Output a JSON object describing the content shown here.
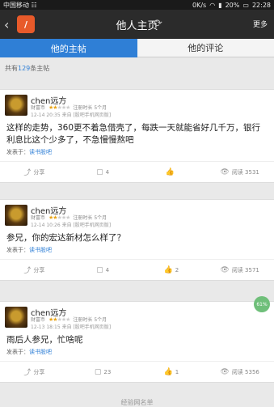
{
  "status": {
    "carrier": "中国移动 ☷",
    "speed": "0K/s",
    "battery": "20%",
    "time": "22:28"
  },
  "header": {
    "back": "‹",
    "title": "他人主页",
    "more": "更多"
  },
  "tabs": [
    "他的主帖",
    "他的评论"
  ],
  "count": {
    "prefix": "共有",
    "num": "129",
    "suffix": "条主帖"
  },
  "posts": [
    {
      "user": "chen远方",
      "level": "财富币",
      "joined": "注册时长 5个月",
      "time": "12-14 20:35",
      "device": "来自 [股吧手机网页版]",
      "content": "这样的走势，360更不着急借壳了，每跌一天就能省好几千万，银行利息比这个少多了，不急慢慢熬吧",
      "source_prefix": "发表于：",
      "source_link": "读书股吧",
      "shares": "分享",
      "comments": "4",
      "likes": "",
      "views": "阅读 3531"
    },
    {
      "user": "chen远方",
      "level": "财富币",
      "joined": "注册时长 5个月",
      "time": "12-14 10:26",
      "device": "来自 [股吧手机网页版]",
      "content": "参兄，你的宏达新材怎么样了？",
      "source_prefix": "发表于：",
      "source_link": "读书股吧",
      "shares": "分享",
      "comments": "4",
      "likes": "2",
      "views": "阅读 3571"
    },
    {
      "user": "chen远方",
      "level": "财富币",
      "joined": "注册时长 5个月",
      "time": "12-13 18:15",
      "device": "来自 [股吧手机网页版]",
      "content": "雨后人参兄，忙啥呢",
      "source_prefix": "发表于：",
      "source_link": "读书股吧",
      "shares": "分享",
      "comments": "23",
      "likes": "1",
      "views": "阅读 5356"
    }
  ],
  "bottom": "经验网名单",
  "float": "61%"
}
